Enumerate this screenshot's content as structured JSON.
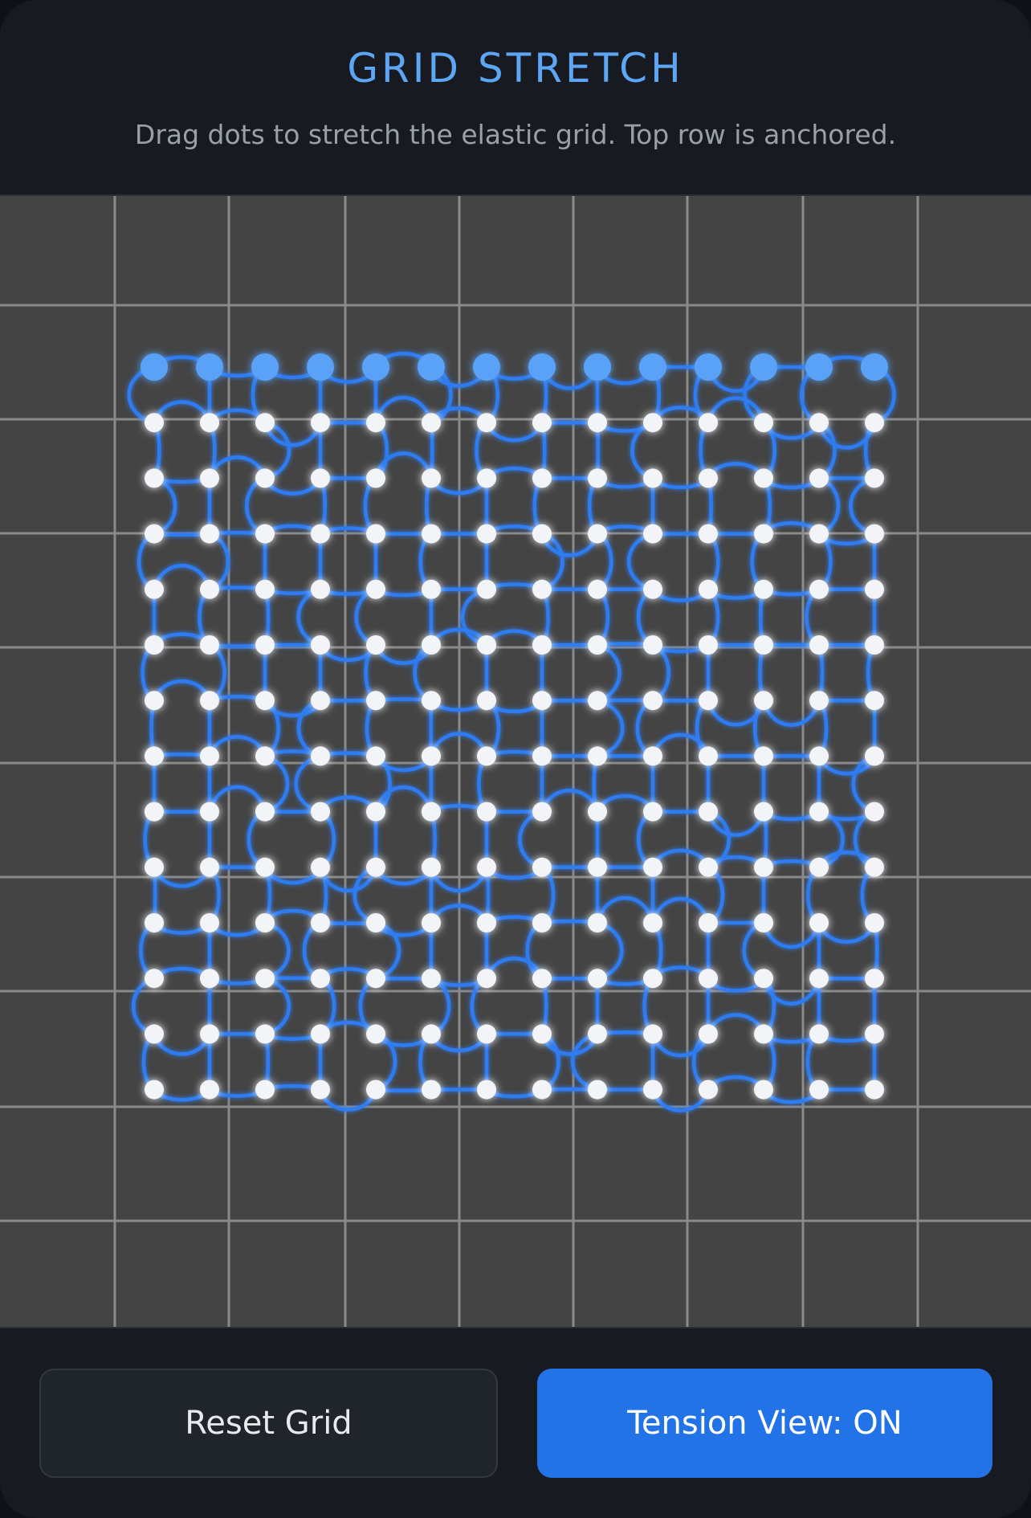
{
  "header": {
    "title": "GRID STRETCH",
    "subtitle": "Drag dots to stretch the elastic grid. Top row is anchored."
  },
  "board": {
    "columns": 14,
    "rows": 14,
    "anchored_row": "top",
    "background_grid_color": "#8a8a8a",
    "spring_color": "#2f7bf0",
    "anchor_dot_color": "#5aa2f8",
    "dot_color": "#f2f4f7"
  },
  "controls": {
    "reset_label": "Reset Grid",
    "tension_label": "Tension View: ON"
  },
  "colors": {
    "accent": "#2272e8",
    "title": "#5da6f5",
    "panel": "#171b21"
  }
}
